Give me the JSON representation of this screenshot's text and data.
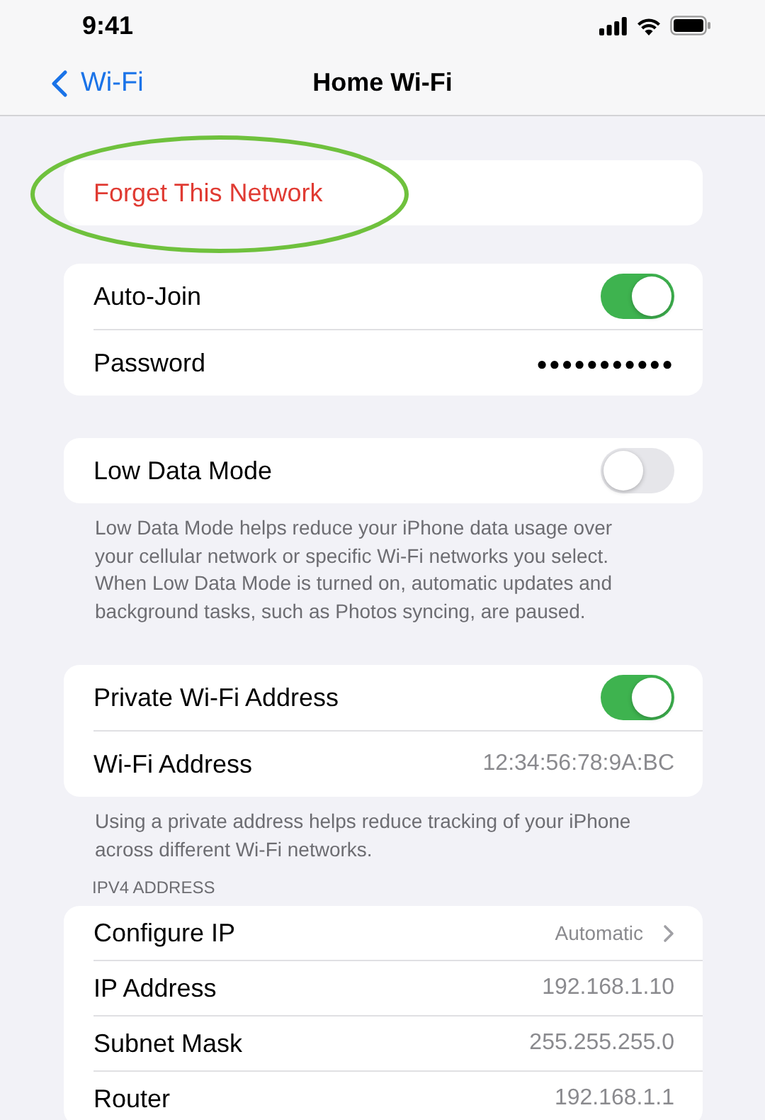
{
  "status_bar": {
    "time": "9:41"
  },
  "nav": {
    "back": "Wi-Fi",
    "title": "Home Wi-Fi"
  },
  "sections": [
    {
      "rows": [
        {
          "kind": "action",
          "label": "Forget This Network",
          "circled": true
        }
      ]
    },
    {
      "rows": [
        {
          "kind": "toggle",
          "label": "Auto-Join",
          "on": true
        },
        {
          "kind": "value",
          "label": "Password",
          "value": "●●●●●●●●●●●"
        }
      ]
    },
    {
      "rows": [
        {
          "kind": "toggle",
          "label": "Low Data Mode",
          "on": false
        }
      ],
      "footer": "Low Data Mode helps reduce your iPhone data usage over your cellular network or specific Wi-Fi networks you select. When Low Data Mode is turned on, automatic updates and background tasks, such as Photos syncing, are paused."
    },
    {
      "rows": [
        {
          "kind": "toggle",
          "label": "Private Wi-Fi Address",
          "on": true
        },
        {
          "kind": "value",
          "label": "Wi-Fi Address",
          "value": "12:34:56:78:9A:BC"
        }
      ],
      "footer": "Using a private address helps reduce tracking of your iPhone across different Wi-Fi networks."
    },
    {
      "header": "IPV4 ADDRESS",
      "rows": [
        {
          "kind": "link",
          "label": "Configure IP",
          "value": "Automatic"
        },
        {
          "kind": "value",
          "label": "IP Address",
          "value": "192.168.1.10"
        },
        {
          "kind": "value",
          "label": "Subnet Mask",
          "value": "255.255.255.0"
        },
        {
          "kind": "value",
          "label": "Router",
          "value": "192.168.1.1"
        }
      ]
    }
  ]
}
